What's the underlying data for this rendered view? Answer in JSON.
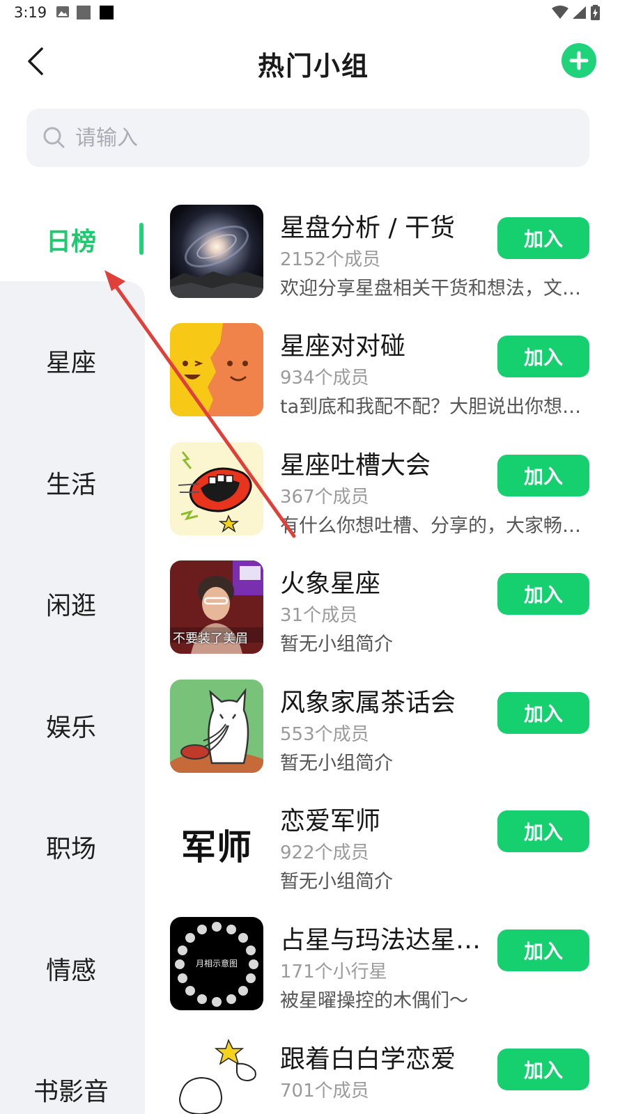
{
  "status_bar": {
    "time": "3:19"
  },
  "header": {
    "title": "热门小组"
  },
  "search": {
    "placeholder": "请输入"
  },
  "sidebar": {
    "items": [
      {
        "label": "日榜",
        "active": true
      },
      {
        "label": "星座"
      },
      {
        "label": "生活"
      },
      {
        "label": "闲逛"
      },
      {
        "label": "娱乐"
      },
      {
        "label": "职场"
      },
      {
        "label": "情感"
      },
      {
        "label": "书影音"
      }
    ]
  },
  "groups": [
    {
      "name": "星盘分析 / 干货",
      "members": "2152个成员",
      "desc": "欢迎分享星盘相关干货和想法，文…",
      "join": "加入",
      "thumb": "galaxy-image"
    },
    {
      "name": "星座对对碰",
      "members": "934个成员",
      "desc": "ta到底和我配不配？大胆说出你想…",
      "join": "加入",
      "thumb": "faces-image"
    },
    {
      "name": "星座吐槽大会",
      "members": "367个成员",
      "desc": "有什么你想吐槽、分享的，大家畅…",
      "join": "加入",
      "thumb": "mouth-image"
    },
    {
      "name": "火象星座",
      "members": "31个成员",
      "desc": "暂无小组简介",
      "join": "加入",
      "thumb": "photo-image",
      "thumb_caption": "不要装了美眉"
    },
    {
      "name": "风象家属茶话会",
      "members": "553个成员",
      "desc": "暂无小组简介",
      "join": "加入",
      "thumb": "cat-image"
    },
    {
      "name": "恋爱军师",
      "members": "922个成员",
      "desc": "暂无小组简介",
      "join": "加入",
      "thumb": "text-image",
      "thumb_text": "军师"
    },
    {
      "name": "占星与玛法达星…",
      "members": "171个小行星",
      "desc": "被星曜操控的木偶们～",
      "join": "加入",
      "thumb": "moon-phases-image",
      "thumb_text": "月相示意图"
    },
    {
      "name": "跟着白白学恋爱",
      "members": "701个成员",
      "desc": "",
      "join": "加入",
      "thumb": "sketch-image"
    }
  ],
  "colors": {
    "accent": "#1ed37a",
    "sidebar_bg": "#f1f2f6",
    "search_bg": "#f2f3f7",
    "annotation": "#e0403a"
  }
}
